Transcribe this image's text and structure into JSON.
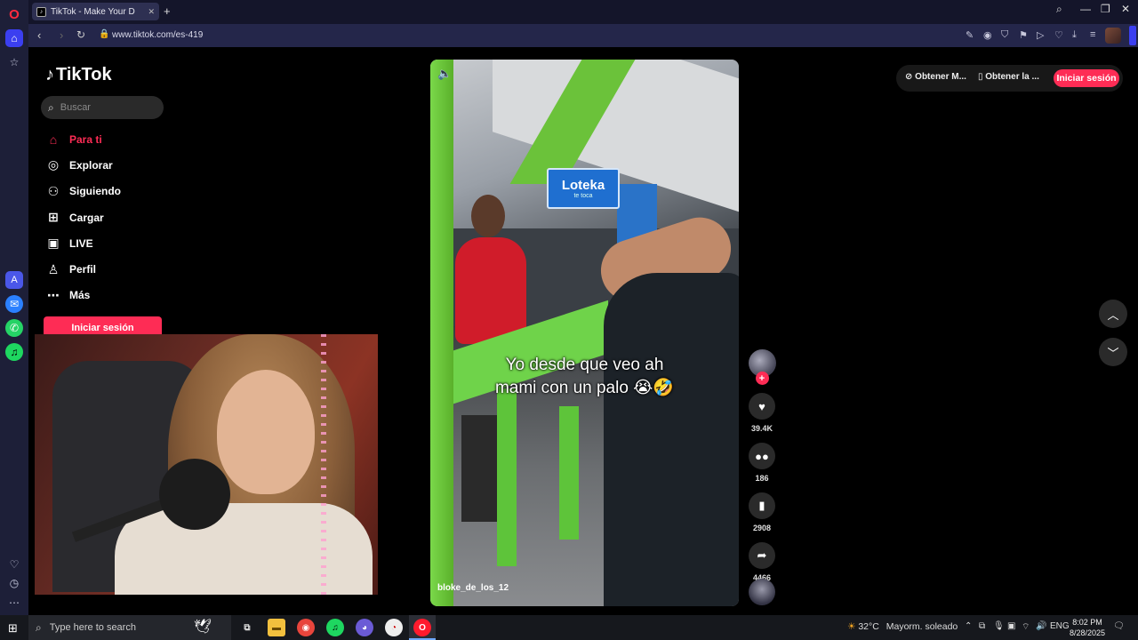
{
  "browser": {
    "tab_title": "TikTok - Make Your D",
    "url": "www.tiktok.com/es-419"
  },
  "sidebar": {
    "logo_text": "TikTok",
    "search_placeholder": "Buscar",
    "items": [
      {
        "label": "Para ti",
        "icon": "home-icon"
      },
      {
        "label": "Explorar",
        "icon": "compass-icon"
      },
      {
        "label": "Siguiendo",
        "icon": "user-follow-icon"
      },
      {
        "label": "Cargar",
        "icon": "upload-icon"
      },
      {
        "label": "LIVE",
        "icon": "live-icon"
      },
      {
        "label": "Perfil",
        "icon": "profile-icon"
      },
      {
        "label": "Más",
        "icon": "more-icon"
      }
    ],
    "login_label": "Iniciar sesión"
  },
  "header": {
    "get_coins_label": "Obtener M...",
    "get_app_label": "Obtener la ...",
    "login_label": "Iniciar sesión"
  },
  "video": {
    "sign_text": "Loteka",
    "sign_subtext": "te toca",
    "caption_line1": "Yo desde que veo ah",
    "caption_line2": "mami con un palo 😭🤣",
    "author": "bloke_de_los_12"
  },
  "actions": {
    "likes": "39.4K",
    "comments": "186",
    "saves": "2908",
    "shares": "4466"
  },
  "taskbar": {
    "search_placeholder": "Type here to search",
    "temperature": "32°C",
    "weather": "Mayorm. soleado",
    "language": "ENG",
    "time": "8:02 PM",
    "date": "8/28/2025"
  },
  "colors": {
    "accent": "#fe2c55",
    "opera_sidebar": "#1d1f38",
    "address_bar": "#24264a"
  }
}
